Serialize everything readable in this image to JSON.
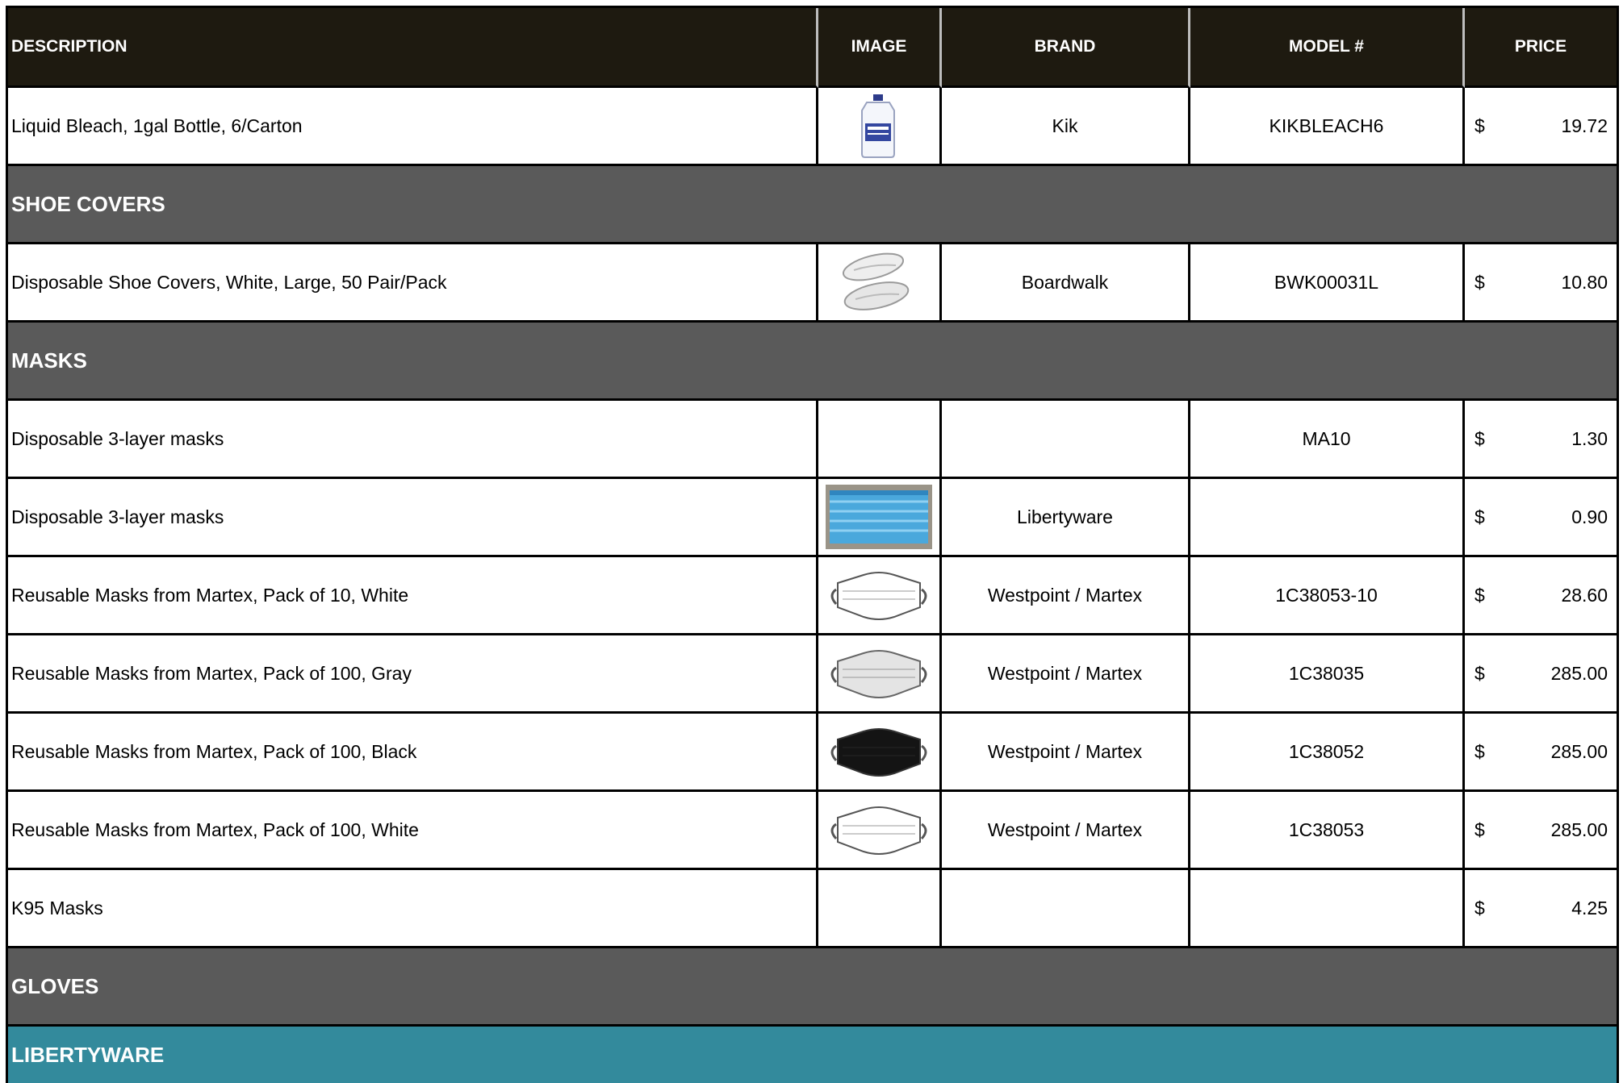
{
  "table": {
    "headers": {
      "description": "DESCRIPTION",
      "image": "IMAGE",
      "brand": "BRAND",
      "model": "MODEL #",
      "price": "PRICE"
    },
    "currency_symbol": "$",
    "rows": [
      {
        "description": "Liquid Bleach, 1gal Bottle, 6/Carton",
        "image_icon": "bleach-bottle-icon",
        "brand": "Kik",
        "model": "KIKBLEACH6",
        "price": "19.72"
      },
      {
        "section": "SHOE COVERS"
      },
      {
        "description": "Disposable Shoe Covers, White, Large, 50 Pair/Pack",
        "image_icon": "shoe-covers-icon",
        "brand": "Boardwalk",
        "model": "BWK00031L",
        "price": "10.80"
      },
      {
        "section": "MASKS"
      },
      {
        "description": "Disposable 3-layer masks",
        "image_icon": "",
        "brand": "",
        "model": "MA10",
        "price": "1.30"
      },
      {
        "description": "Disposable 3-layer masks",
        "image_icon": "blue-mask-box-icon",
        "brand": "Libertyware",
        "model": "",
        "price": "0.90"
      },
      {
        "description": "Reusable Masks from Martex, Pack of 10, White",
        "image_icon": "white-mask-icon",
        "brand": "Westpoint  / Martex",
        "model": "1C38053-10",
        "price": "28.60"
      },
      {
        "description": "Reusable Masks from Martex, Pack of 100, Gray",
        "image_icon": "gray-mask-icon",
        "brand": "Westpoint  / Martex",
        "model": "1C38035",
        "price": "285.00"
      },
      {
        "description": "Reusable Masks from Martex, Pack of 100, Black",
        "image_icon": "black-mask-icon",
        "brand": "Westpoint  / Martex",
        "model": "1C38052",
        "price": "285.00"
      },
      {
        "description": "Reusable Masks from Martex, Pack of 100, White",
        "image_icon": "white-mask-icon",
        "brand": "Westpoint  / Martex",
        "model": "1C38053",
        "price": "285.00"
      },
      {
        "description": "K95 Masks",
        "image_icon": "",
        "brand": "",
        "model": "",
        "price": "4.25"
      },
      {
        "section": "GLOVES"
      },
      {
        "subsection": "LIBERTYWARE"
      }
    ]
  },
  "colors": {
    "header_bg": "#1e1a10",
    "section_bg": "#5a5a5a",
    "subsection_bg": "#338a9c"
  }
}
